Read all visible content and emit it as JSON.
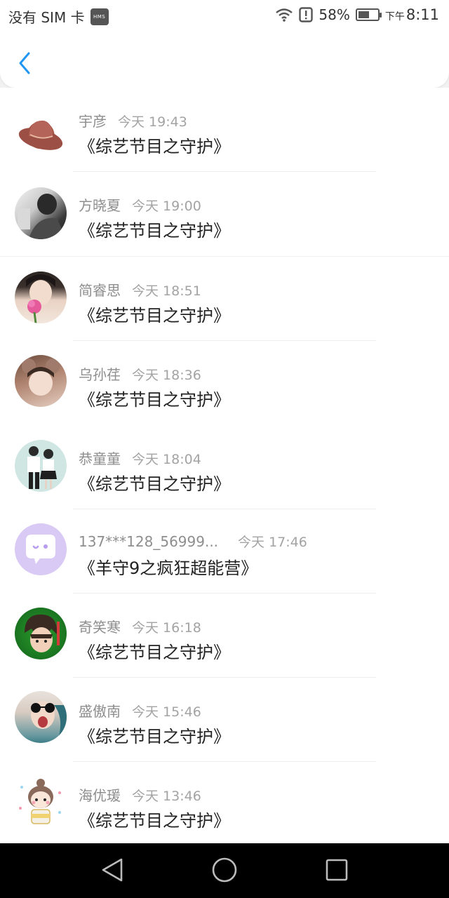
{
  "status_bar": {
    "carrier": "没有 SIM 卡",
    "hms": "HMS",
    "battery": "58%",
    "ampm": "下午",
    "time": "8:11",
    "battery_level": 0.58
  },
  "header": {
    "back_icon": "chevron-left-icon",
    "accent": "#2196f3"
  },
  "messages": [
    {
      "name": "宇彦",
      "time": "今天 19:43",
      "title": "《综艺节目之守护》"
    },
    {
      "name": "方晓夏",
      "time": "今天 19:00",
      "title": "《综艺节目之守护》"
    },
    {
      "name": "简睿思",
      "time": "今天 18:51",
      "title": "《综艺节目之守护》"
    },
    {
      "name": "乌孙荏",
      "time": "今天 18:36",
      "title": "《综艺节目之守护》"
    },
    {
      "name": "恭童童",
      "time": "今天 18:04",
      "title": "《综艺节目之守护》"
    },
    {
      "name": "137***128_56999...",
      "time": "今天 17:46",
      "title": "《羊守9之疯狂超能营》"
    },
    {
      "name": "奇笑寒",
      "time": "今天 16:18",
      "title": "《综艺节目之守护》"
    },
    {
      "name": "盛傲南",
      "time": "今天 15:46",
      "title": "《综艺节目之守护》"
    },
    {
      "name": "海优瑗",
      "time": "今天 13:46",
      "title": "《综艺节目之守护》"
    }
  ],
  "nav": {
    "back": "triangle-back-icon",
    "home": "circle-home-icon",
    "recents": "square-recents-icon"
  }
}
